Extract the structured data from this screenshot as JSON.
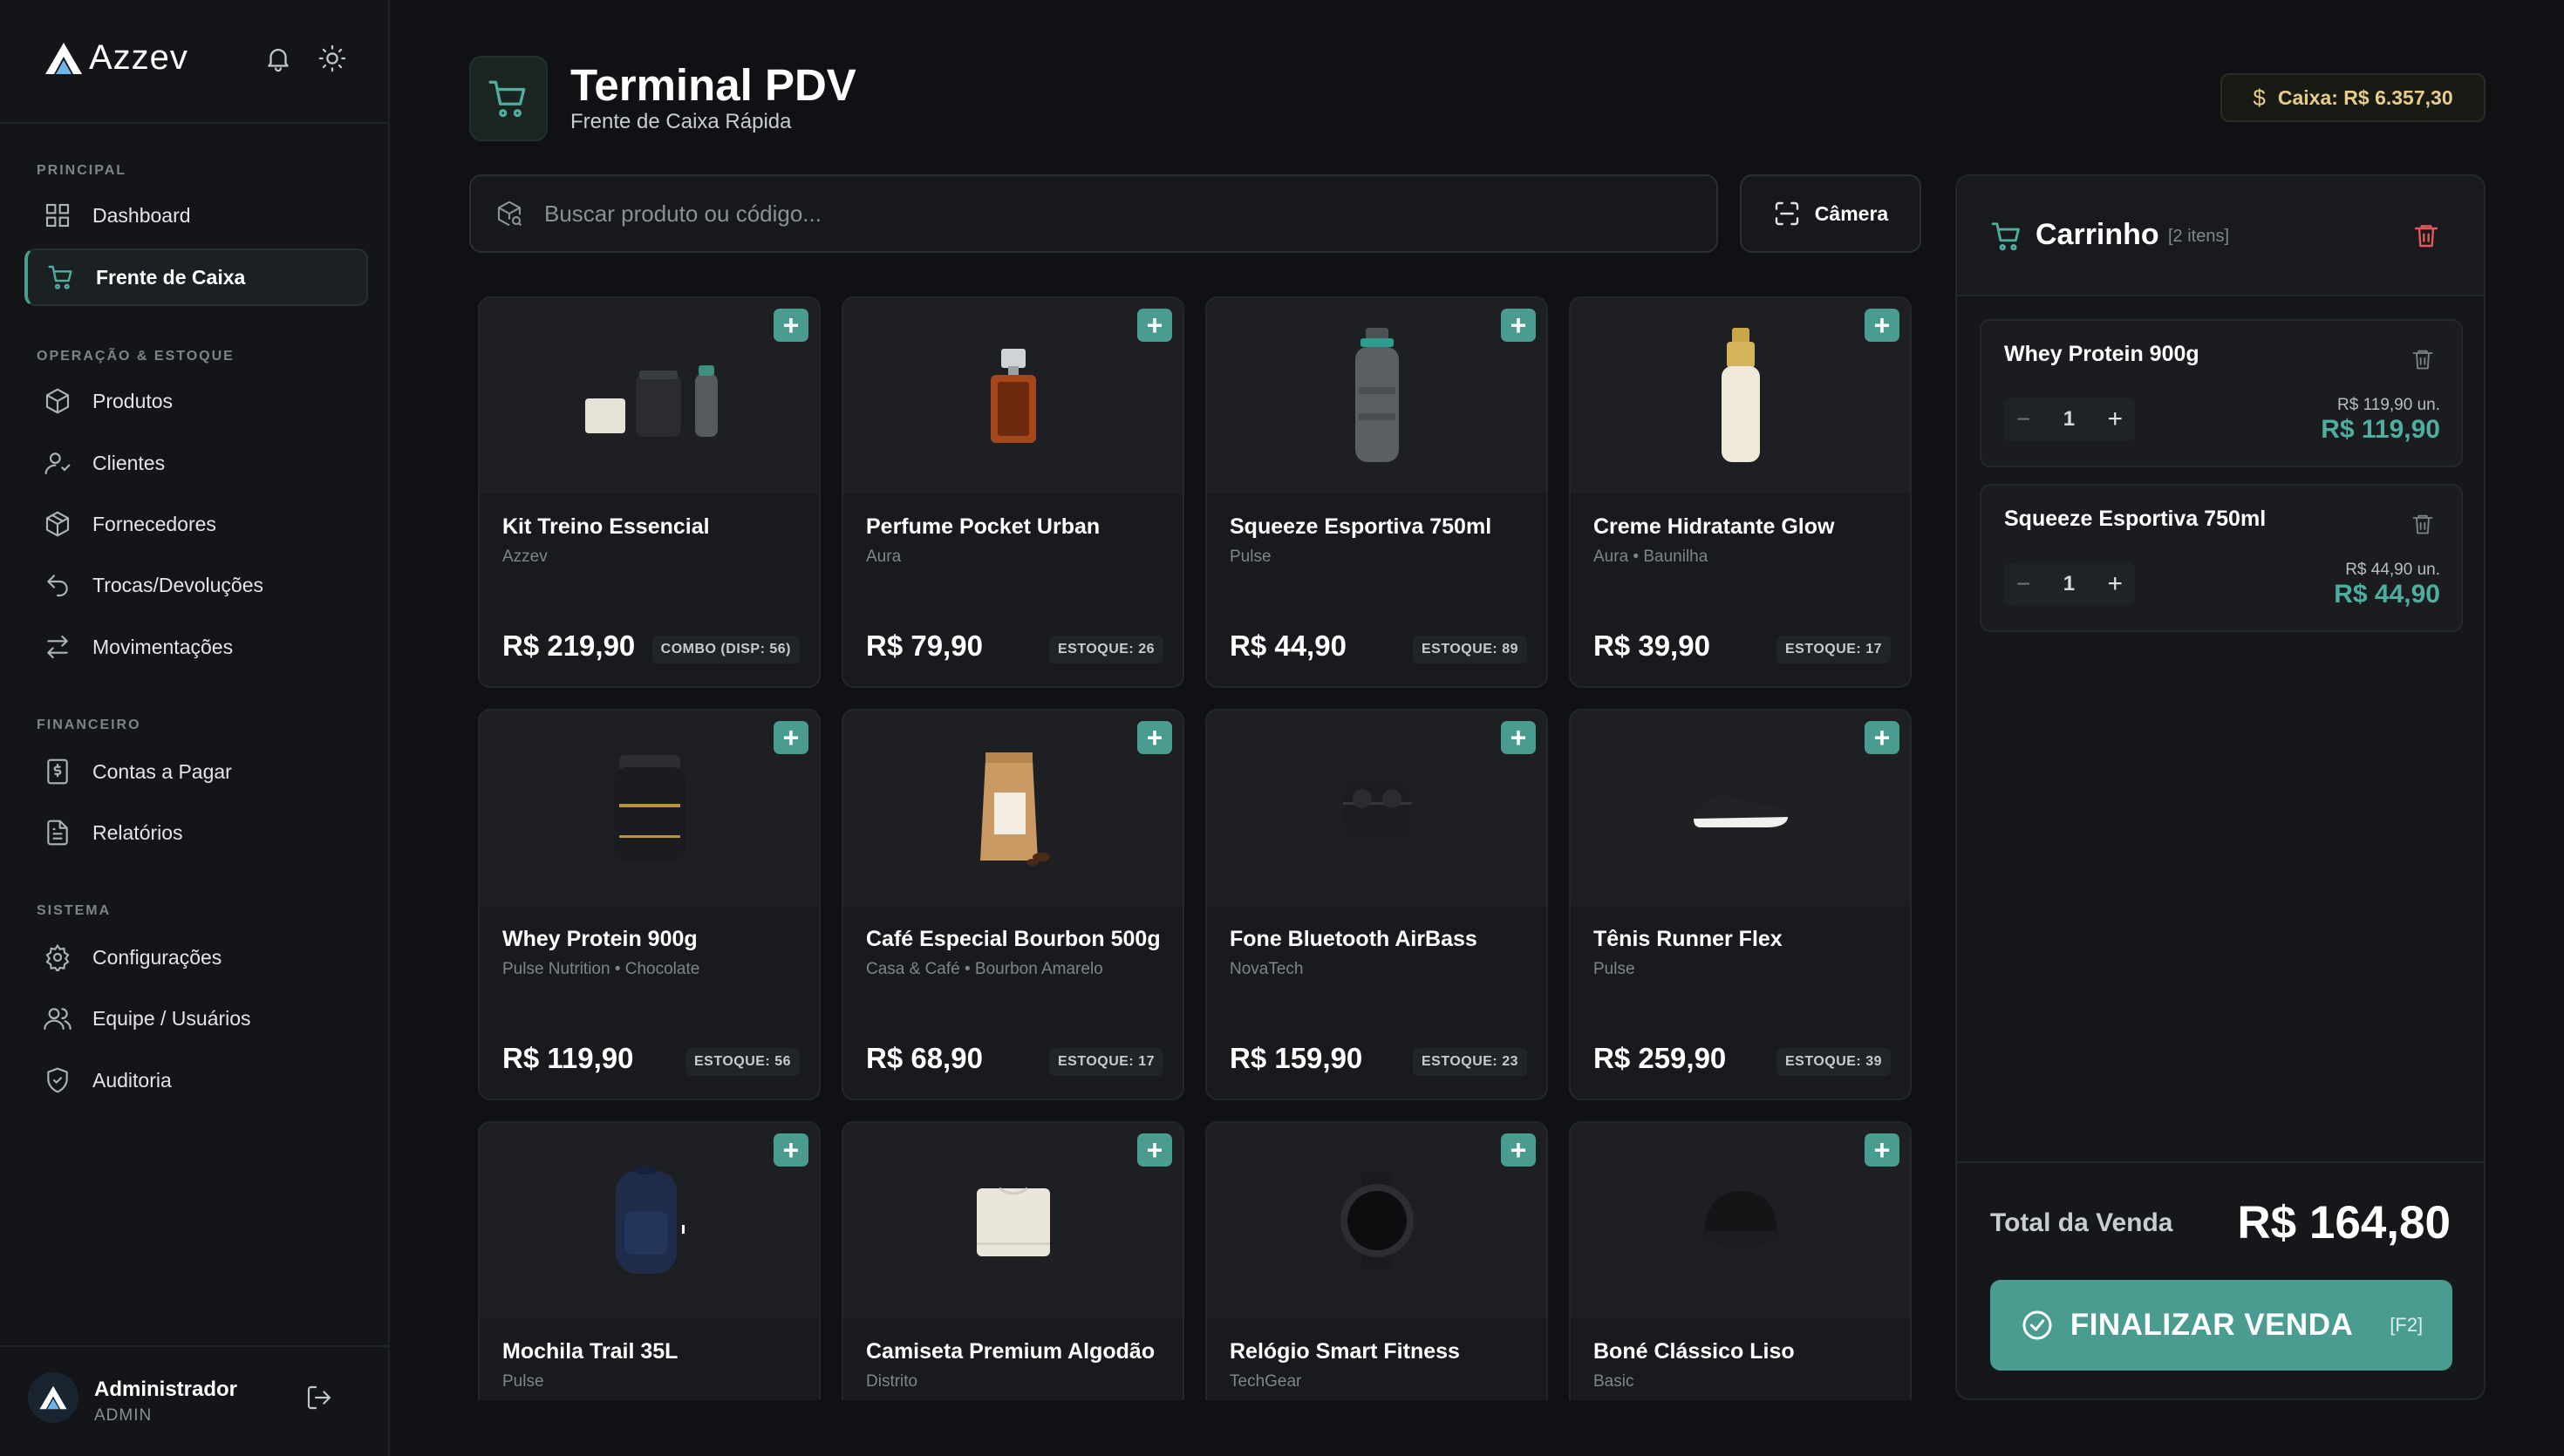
{
  "app": {
    "brand": "Azzev",
    "icons": [
      "bell-icon",
      "sun-icon"
    ]
  },
  "sidebar": {
    "sections": {
      "principal": "PRINCIPAL",
      "operacao": "OPERAÇÃO & ESTOQUE",
      "financeiro": "FINANCEIRO",
      "sistema": "SISTEMA"
    },
    "items": [
      {
        "label": "Dashboard",
        "icon": "grid-icon"
      },
      {
        "label": "Frente de Caixa",
        "icon": "cart-icon",
        "active": true
      },
      {
        "label": "Produtos",
        "icon": "box-icon"
      },
      {
        "label": "Clientes",
        "icon": "user-icon"
      },
      {
        "label": "Fornecedores",
        "icon": "package-icon"
      },
      {
        "label": "Trocas/Devoluções",
        "icon": "undo-icon"
      },
      {
        "label": "Movimentações",
        "icon": "arrows-icon"
      },
      {
        "label": "Contas a Pagar",
        "icon": "bill-icon"
      },
      {
        "label": "Relatórios",
        "icon": "report-icon"
      },
      {
        "label": "Configurações",
        "icon": "gear-icon"
      },
      {
        "label": "Equipe / Usuários",
        "icon": "team-icon"
      },
      {
        "label": "Auditoria",
        "icon": "shield-icon"
      }
    ],
    "user": {
      "name": "Administrador",
      "role": "ADMIN"
    }
  },
  "header": {
    "title": "Terminal PDV",
    "subtitle": "Frente de Caixa Rápida",
    "cash": "Caixa: R$ 6.357,30"
  },
  "search": {
    "placeholder": "Buscar produto ou código...",
    "camera_label": "Câmera"
  },
  "products": [
    {
      "name": "Kit Treino Essencial",
      "brand": "Azzev",
      "price": "R$ 219,90",
      "stock": "COMBO (DISP: 56)",
      "image": "kit"
    },
    {
      "name": "Perfume Pocket Urban",
      "brand": "Aura",
      "price": "R$ 79,90",
      "stock": "ESTOQUE: 26",
      "image": "perfume"
    },
    {
      "name": "Squeeze Esportiva 750ml",
      "brand": "Pulse",
      "price": "R$ 44,90",
      "stock": "ESTOQUE: 89",
      "image": "bottle"
    },
    {
      "name": "Creme Hidratante Glow",
      "brand": "Aura • Baunilha",
      "price": "R$ 39,90",
      "stock": "ESTOQUE: 17",
      "image": "cream"
    },
    {
      "name": "Whey Protein 900g",
      "brand": "Pulse Nutrition • Chocolate",
      "price": "R$ 119,90",
      "stock": "ESTOQUE: 56",
      "image": "whey"
    },
    {
      "name": "Café Especial Bourbon 500g",
      "brand": "Casa & Café • Bourbon Amarelo",
      "price": "R$ 68,90",
      "stock": "ESTOQUE: 17",
      "image": "coffee"
    },
    {
      "name": "Fone Bluetooth AirBass",
      "brand": "NovaTech",
      "price": "R$ 159,90",
      "stock": "ESTOQUE: 23",
      "image": "earbuds"
    },
    {
      "name": "Tênis Runner Flex",
      "brand": "Pulse",
      "price": "R$ 259,90",
      "stock": "ESTOQUE: 39",
      "image": "shoe"
    },
    {
      "name": "Mochila Trail 35L",
      "brand": "Pulse",
      "price": "",
      "stock": "",
      "image": "backpack"
    },
    {
      "name": "Camiseta Premium Algodão",
      "brand": "Distrito",
      "price": "",
      "stock": "",
      "image": "tshirt"
    },
    {
      "name": "Relógio Smart Fitness",
      "brand": "TechGear",
      "price": "",
      "stock": "",
      "image": "watch"
    },
    {
      "name": "Boné Clássico Liso",
      "brand": "Basic",
      "price": "",
      "stock": "",
      "image": "cap"
    }
  ],
  "cart": {
    "title": "Carrinho",
    "count": "[2 itens]",
    "items": [
      {
        "name": "Whey Protein 900g",
        "qty": "1",
        "unit": "R$ 119,90 un.",
        "total": "R$ 119,90"
      },
      {
        "name": "Squeeze Esportiva 750ml",
        "qty": "1",
        "unit": "R$ 44,90 un.",
        "total": "R$ 44,90"
      }
    ],
    "total_label": "Total da Venda",
    "total_value": "R$ 164,80",
    "finalize_label": "FINALIZAR VENDA",
    "finalize_key": "[F2]"
  },
  "colors": {
    "accent": "#4a9c90",
    "accent_text": "#4fae9f",
    "background": "#0f1114",
    "cash_text": "#e7cd8a",
    "danger": "#e05858"
  }
}
